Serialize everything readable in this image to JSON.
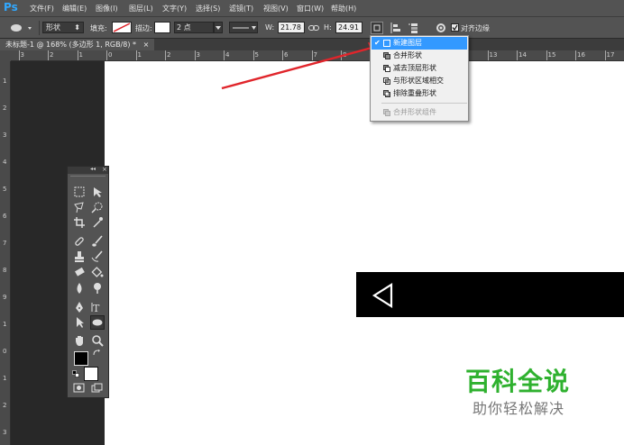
{
  "app": {
    "logo": "Ps"
  },
  "menubar": {
    "items": [
      "文件(F)",
      "编辑(E)",
      "图像(I)",
      "图层(L)",
      "文字(Y)",
      "选择(S)",
      "滤镜(T)",
      "视图(V)",
      "窗口(W)",
      "帮助(H)"
    ]
  },
  "options": {
    "mode": "形状",
    "fill_label": "填充:",
    "stroke_label": "描边:",
    "stroke_width": "2 点",
    "w_label": "W:",
    "w_value": "21.78",
    "h_label": "H:",
    "h_value": "24.91",
    "align_edges": "对齐边缘"
  },
  "document": {
    "tab_title": "未标题-1 @ 168% (多边形 1, RGB/8) *",
    "close": "×"
  },
  "ruler_top": [
    "3",
    "2",
    "1",
    "0",
    "1",
    "2",
    "3",
    "4",
    "5",
    "6",
    "7",
    "8",
    "9",
    "10",
    "11",
    "12",
    "13",
    "14",
    "15",
    "16",
    "17"
  ],
  "ruler_left": [
    "1",
    "2",
    "3",
    "4",
    "5",
    "6",
    "7",
    "8",
    "9",
    "1",
    "0",
    "1",
    "2",
    "3"
  ],
  "dropdown": {
    "items": [
      "新建图层",
      "合并形状",
      "减去顶层形状",
      "与形状区域相交",
      "排除重叠形状"
    ],
    "disabled_item": "合并形状组件",
    "checked_index": 0
  },
  "tools_panel": {
    "collapse": "◂◂",
    "close": "×"
  },
  "watermark": {
    "brand": "百科全说",
    "slogan": "助你轻松解决"
  },
  "colors": {
    "accent": "#3399ff",
    "highlight": "#1e90ff",
    "annotation": "#e0252b",
    "watermark_green": "#2fb12f"
  }
}
